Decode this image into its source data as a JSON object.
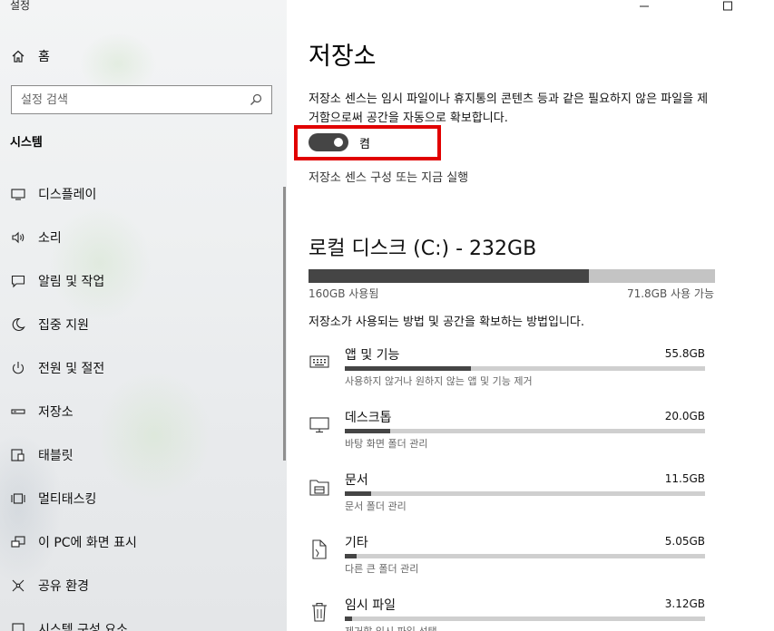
{
  "window": {
    "title": "설정"
  },
  "sidebar": {
    "home_label": "홈",
    "search_placeholder": "설정 검색",
    "section_title": "시스템",
    "items": [
      {
        "label": "디스플레이",
        "icon": "monitor-icon"
      },
      {
        "label": "소리",
        "icon": "speaker-icon"
      },
      {
        "label": "알림 및 작업",
        "icon": "notification-icon"
      },
      {
        "label": "집중 지원",
        "icon": "moon-icon"
      },
      {
        "label": "전원 및 절전",
        "icon": "power-icon"
      },
      {
        "label": "저장소",
        "icon": "storage-icon"
      },
      {
        "label": "태블릿",
        "icon": "tablet-icon"
      },
      {
        "label": "멀티태스킹",
        "icon": "multitasking-icon"
      },
      {
        "label": "이 PC에 화면 표시",
        "icon": "project-icon"
      },
      {
        "label": "공유 환경",
        "icon": "shared-experiences-icon"
      },
      {
        "label": "시스템 구성 요소",
        "icon": "components-icon"
      }
    ]
  },
  "main": {
    "title": "저장소",
    "description": "저장소 센스는 임시 파일이나 휴지통의 콘텐츠 등과 같은 필요하지 않은 파일을 제거함으로써 공간을 자동으로 확보합니다.",
    "toggle": {
      "state": "on",
      "label": "켬"
    },
    "configure_link": "저장소 센스 구성 또는 지금 실행",
    "drive": {
      "title": "로컬 디스크 (C:) - 232GB",
      "used": "160GB 사용됨",
      "free": "71.8GB 사용 가능",
      "used_fraction": 0.69
    },
    "usage_description": "저장소가 사용되는 방법 및 공간을 확보하는 방법입니다.",
    "categories": [
      {
        "name": "앱 및 기능",
        "size": "55.8GB",
        "sub": "사용하지 않거나 원하지 않는 앱 및 기능 제거",
        "fraction": 0.35,
        "icon": "keyboard-icon"
      },
      {
        "name": "데스크톱",
        "size": "20.0GB",
        "sub": "바탕 화면 폴더 관리",
        "fraction": 0.125,
        "icon": "desktop-icon"
      },
      {
        "name": "문서",
        "size": "11.5GB",
        "sub": "문서 폴더 관리",
        "fraction": 0.072,
        "icon": "documents-folder-icon"
      },
      {
        "name": "기타",
        "size": "5.05GB",
        "sub": "다른 큰 폴더 관리",
        "fraction": 0.032,
        "icon": "other-icon"
      },
      {
        "name": "임시 파일",
        "size": "3.12GB",
        "sub": "제거할 임시 파일 선택",
        "fraction": 0.02,
        "icon": "trash-icon"
      }
    ]
  }
}
